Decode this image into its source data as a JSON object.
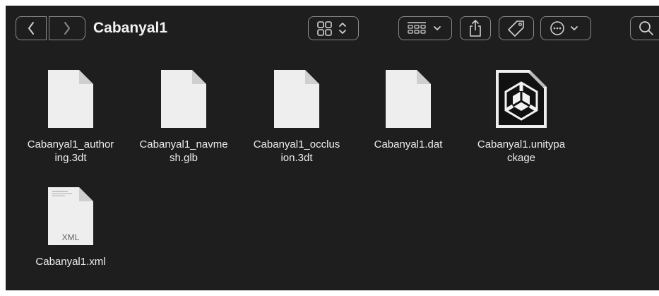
{
  "toolbar": {
    "title": "Cabanyal1",
    "back_icon": "chevron-left-icon",
    "forward_icon": "chevron-right-icon",
    "view_icon": "icon-grid-icon",
    "group_icon": "group-by-icon",
    "share_icon": "share-icon",
    "tag_icon": "tag-icon",
    "more_icon": "ellipsis-circle-icon",
    "search_icon": "search-icon"
  },
  "files": [
    {
      "name": "Cabanyal1_author\ning.3dt",
      "icon": "document-icon"
    },
    {
      "name": "Cabanyal1_navme\nsh.glb",
      "icon": "document-icon"
    },
    {
      "name": "Cabanyal1_occlus\nion.3dt",
      "icon": "document-icon"
    },
    {
      "name": "Cabanyal1.dat",
      "icon": "document-icon"
    },
    {
      "name": "Cabanyal1.unitypa\nckage",
      "icon": "unity-package-icon"
    },
    {
      "name": "Cabanyal1.xml",
      "icon": "xml-document-icon",
      "badge": "XML"
    }
  ],
  "colors": {
    "background": "#1e1e1e",
    "toolbar_border": "#8a8a8a",
    "text": "#ededed"
  }
}
